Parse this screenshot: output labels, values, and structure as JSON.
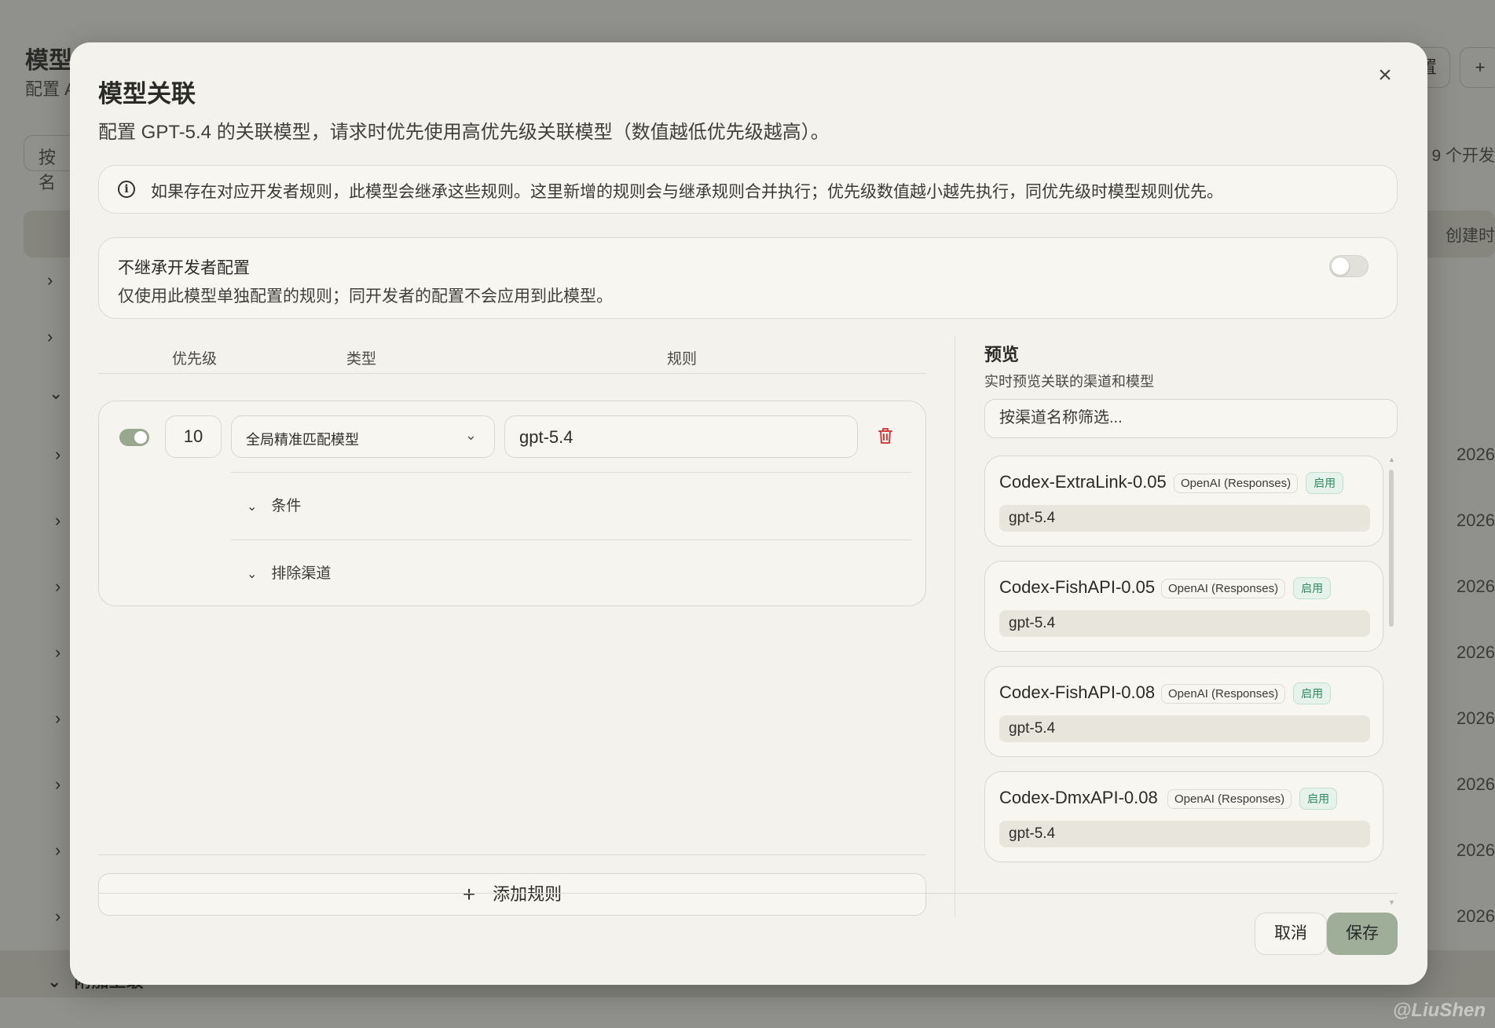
{
  "background": {
    "title": "模型",
    "subtitle": "配置 A",
    "search_placeholder": "按名",
    "count_text": "9 个开发",
    "created_header": "创建时",
    "btn1": "置",
    "btn2": "+",
    "year_text": "2026",
    "bottom_group": "附加上级",
    "watermark": "@LiuShen"
  },
  "modal": {
    "title": "模型关联",
    "description": "配置 GPT-5.4 的关联模型，请求时优先使用高优先级关联模型（数值越低优先级越高）。",
    "close_icon": "×",
    "info_text": "如果存在对应开发者规则，此模型会继承这些规则。这里新增的规则会与继承规则合并执行；优先级数值越小越先执行，同优先级时模型规则优先。",
    "inherit": {
      "title": "不继承开发者配置",
      "description": "仅使用此模型单独配置的规则；同开发者的配置不会应用到此模型。",
      "enabled": false
    },
    "rules_header": {
      "priority": "优先级",
      "type": "类型",
      "rule": "规则"
    },
    "rule": {
      "enabled": true,
      "priority": "10",
      "type": "全局精准匹配模型",
      "value": "gpt-5.4",
      "conditions_label": "条件",
      "exclude_label": "排除渠道"
    },
    "add_rule_label": "添加规则",
    "preview": {
      "title": "预览",
      "subtitle": "实时预览关联的渠道和模型",
      "filter_placeholder": "按渠道名称筛选...",
      "channels": [
        {
          "name": "Codex-ExtraLink-0.05",
          "type": "OpenAI (Responses)",
          "status": "启用",
          "model": "gpt-5.4"
        },
        {
          "name": "Codex-FishAPI-0.05",
          "type": "OpenAI (Responses)",
          "status": "启用",
          "model": "gpt-5.4"
        },
        {
          "name": "Codex-FishAPI-0.08",
          "type": "OpenAI (Responses)",
          "status": "启用",
          "model": "gpt-5.4"
        },
        {
          "name": "Codex-DmxAPI-0.08",
          "type": "OpenAI (Responses)",
          "status": "启用",
          "model": "gpt-5.4"
        }
      ]
    },
    "cancel_label": "取消",
    "save_label": "保存"
  },
  "colors": {
    "accent": "#9fae98",
    "status_green": "#2e8a5c",
    "danger": "#d84040"
  }
}
